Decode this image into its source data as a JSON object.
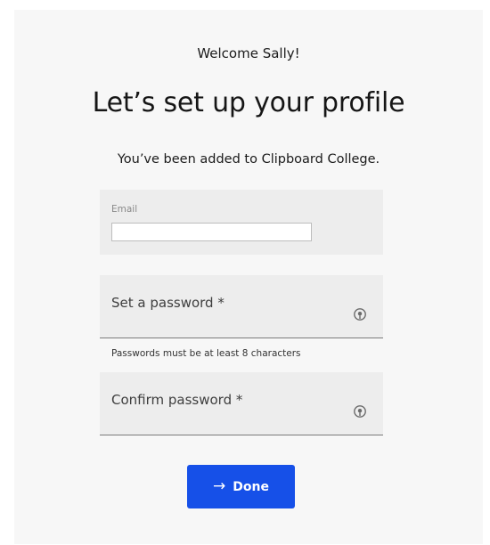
{
  "header": {
    "welcome": "Welcome Sally!",
    "title": "Let’s set up your profile",
    "subtitle": "You’ve been added to Clipboard College."
  },
  "form": {
    "email": {
      "label": "Email",
      "value": ""
    },
    "password": {
      "placeholder": "Set a password *",
      "hint": "Passwords must be at least 8 characters",
      "icon": "show-password-icon"
    },
    "confirm_password": {
      "placeholder": "Confirm password *",
      "icon": "show-password-icon"
    }
  },
  "actions": {
    "done_label": "Done",
    "done_icon": "arrow-right-icon"
  },
  "colors": {
    "accent": "#1650e8",
    "panel_background": "#f7f7f7",
    "field_background": "#ededed"
  }
}
